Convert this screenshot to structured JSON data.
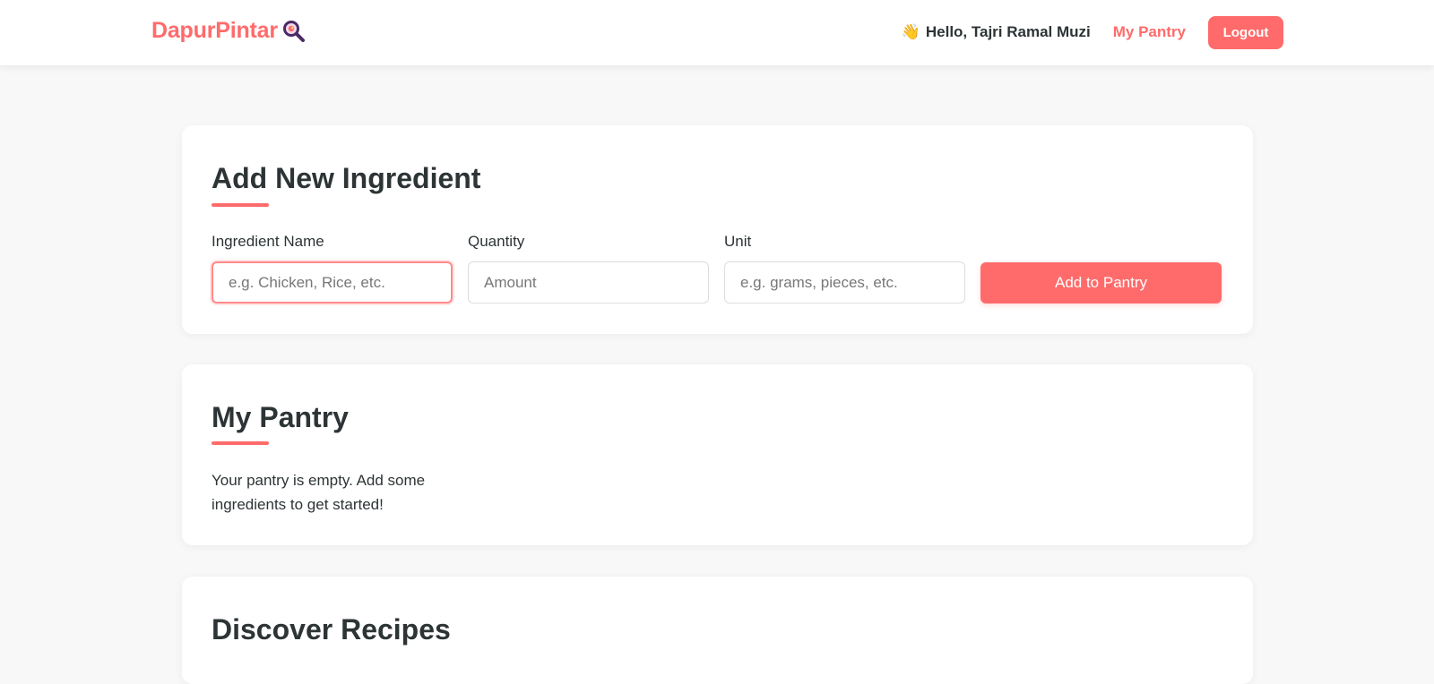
{
  "navbar": {
    "brand": "DapurPintar",
    "brand_icon": "magnifier-pan-icon",
    "wave_icon": "waving-hand-icon",
    "greeting": "Hello, Tajri Ramal Muzi",
    "my_pantry_link": "My Pantry",
    "logout_label": "Logout"
  },
  "add_ingredient": {
    "title": "Add New Ingredient",
    "fields": {
      "name": {
        "label": "Ingredient Name",
        "placeholder": "e.g. Chicken, Rice, etc.",
        "value": ""
      },
      "quantity": {
        "label": "Quantity",
        "placeholder": "Amount",
        "value": ""
      },
      "unit": {
        "label": "Unit",
        "placeholder": "e.g. grams, pieces, etc.",
        "value": ""
      }
    },
    "submit_label": "Add to Pantry"
  },
  "pantry": {
    "title": "My Pantry",
    "empty_message": "Your pantry is empty. Add some ingredients to get started!"
  },
  "recipes": {
    "title": "Discover Recipes"
  },
  "colors": {
    "accent": "#ff6b6b",
    "text": "#2d3436",
    "background": "#f8f8f8",
    "icon_purple": "#4a2a66"
  }
}
